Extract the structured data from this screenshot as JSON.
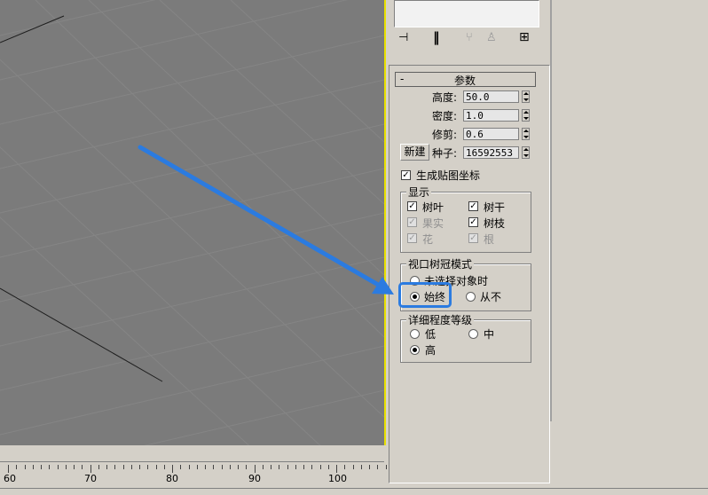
{
  "params_rollout": {
    "collapse_symbol": "-",
    "title": "参数",
    "height": {
      "label": "高度:",
      "value": "50.0"
    },
    "density": {
      "label": "密度:",
      "value": "1.0"
    },
    "prune": {
      "label": "修剪:",
      "value": "0.6"
    },
    "new_button": "新建",
    "seed": {
      "label": "种子:",
      "value": "16592553"
    },
    "gen_mapping": {
      "label": "生成贴图坐标",
      "checked": true
    }
  },
  "display_group": {
    "title": "显示",
    "leaves": {
      "label": "树叶",
      "checked": true
    },
    "trunk": {
      "label": "树干",
      "checked": true
    },
    "fruit": {
      "label": "果实",
      "checked": true,
      "disabled": true
    },
    "branches": {
      "label": "树枝",
      "checked": true
    },
    "flowers": {
      "label": "花",
      "checked": true,
      "disabled": true
    },
    "roots": {
      "label": "根",
      "checked": true,
      "disabled": true
    }
  },
  "canopy_group": {
    "title": "视口树冠模式",
    "when_not_selected": {
      "label": "未选择对象时",
      "selected": false
    },
    "always": {
      "label": "始终",
      "selected": true
    },
    "never": {
      "label": "从不",
      "selected": false
    }
  },
  "detail_group": {
    "title": "详细程度等级",
    "low": {
      "label": "低",
      "selected": false
    },
    "medium": {
      "label": "中",
      "selected": false
    },
    "high": {
      "label": "高",
      "selected": true
    }
  },
  "timeline": {
    "labels": [
      "60",
      "70",
      "80",
      "90",
      "100"
    ]
  },
  "colors": {
    "viewport_bg": "#7b7b7b",
    "viewport_border": "#e8e000",
    "panel_bg": "#d4d0c8",
    "highlight": "#2b7be0"
  }
}
